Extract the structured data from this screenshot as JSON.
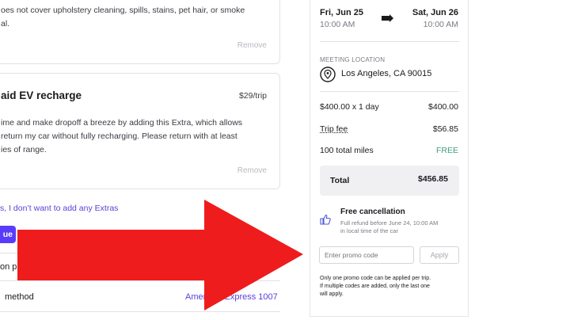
{
  "extras": {
    "card1": {
      "desc_line1": "oes not cover upholstery cleaning, spills, stains, pet hair, or smoke",
      "desc_line2": "al.",
      "remove": "Remove"
    },
    "card2": {
      "title": "aid EV recharge",
      "price": "$29/trip",
      "desc_line1": "ime and make dropoff a breeze by adding this Extra, which allows",
      "desc_line2": "return my car without fully recharging. Please return with at least",
      "desc_line3": "ies of range.",
      "remove": "Remove"
    },
    "no_extras_link": "s, I don’t want to add any Extras",
    "continue_label": "ue",
    "protection_label": "on pla",
    "payment": {
      "label": "method",
      "value": "American Express 1007"
    }
  },
  "trip": {
    "start_date": "Fri, Jun 25",
    "start_time": "10:00 AM",
    "end_date": "Sat, Jun 26",
    "end_time": "10:00 AM",
    "meeting_label": "MEETING LOCATION",
    "location": "Los Angeles, CA 90015",
    "line1_label": "$400.00 x 1 day",
    "line1_value": "$400.00",
    "fee_label": "Trip fee",
    "fee_value": "$56.85",
    "miles_label": "100 total miles",
    "miles_value": "FREE",
    "total_label": "Total",
    "total_value": "$456.85",
    "cancel_title": "Free cancellation",
    "cancel_line1": "Full refund before June 24, 10:00 AM",
    "cancel_line2": "in local time of the car",
    "promo_placeholder": "Enter promo code",
    "apply_label": "Apply",
    "promo_note1": "Only one promo code can be applied per trip.",
    "promo_note2": "If multiple codes are added, only the last one",
    "promo_note3": "will apply."
  },
  "colors": {
    "accent": "#593cfb",
    "arrow": "#ee1c1c",
    "free": "#3f9f7a"
  },
  "icons": [
    "arrow-right-icon",
    "location-pin-icon",
    "thumbs-up-icon"
  ]
}
